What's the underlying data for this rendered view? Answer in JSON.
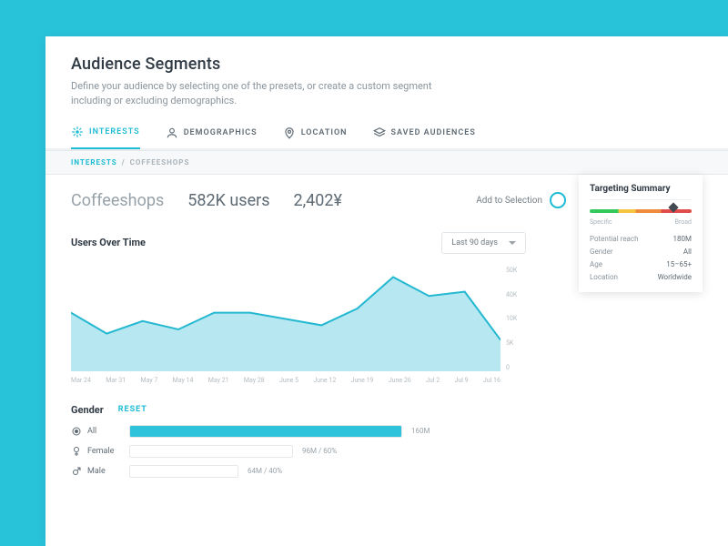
{
  "header": {
    "title": "Audience Segments",
    "subtitle": "Define your audience by selecting one of the presets, or create a custom segment including or excluding demographics."
  },
  "tabs": [
    {
      "label": "INTERESTS",
      "active": true
    },
    {
      "label": "DEMOGRAPHICS",
      "active": false
    },
    {
      "label": "LOCATION",
      "active": false
    },
    {
      "label": "SAVED AUDIENCES",
      "active": false
    }
  ],
  "breadcrumb": {
    "root": "INTERESTS",
    "leaf": "COFFEESHOPS"
  },
  "segment": {
    "name": "Coffeeshops",
    "users": "582K users",
    "price": "2,402¥",
    "add_label": "Add to Selection"
  },
  "chart_label": "Users Over Time",
  "dropdown_label": "Last 90 days",
  "chart_data": {
    "type": "area",
    "title": "Users Over Time",
    "xlabel": "",
    "ylabel": "",
    "ylim": [
      0,
      50000
    ],
    "y_ticks": [
      "50K",
      "40K",
      "10K",
      "5K",
      "0"
    ],
    "categories": [
      "Mar 24",
      "Mar 31",
      "May 7",
      "May 14",
      "May 21",
      "May 28",
      "June 5",
      "June 12",
      "June 19",
      "June 26",
      "Jul 2",
      "Jul 9",
      "Jul 16"
    ],
    "values": [
      28000,
      18000,
      24000,
      20000,
      28000,
      28000,
      25000,
      22000,
      30000,
      45000,
      36000,
      38000,
      15000
    ]
  },
  "gender": {
    "title": "Gender",
    "reset": "RESET",
    "rows": [
      {
        "key": "All",
        "value_label": "160M",
        "fill_pct": 100,
        "selected": true
      },
      {
        "key": "Female",
        "value_label": "96M / 60%",
        "fill_pct": 60,
        "selected": false
      },
      {
        "key": "Male",
        "value_label": "64M / 40%",
        "fill_pct": 40,
        "selected": false
      }
    ]
  },
  "summary": {
    "title": "Targeting Summary",
    "gauge_pos": 0.82,
    "gauge_left": "Specific",
    "gauge_right": "Broad",
    "rows": [
      {
        "k": "Potential reach",
        "v": "180M"
      },
      {
        "k": "Gender",
        "v": "All"
      },
      {
        "k": "Age",
        "v": "15–65+"
      },
      {
        "k": "Location",
        "v": "Worldwide"
      }
    ]
  }
}
